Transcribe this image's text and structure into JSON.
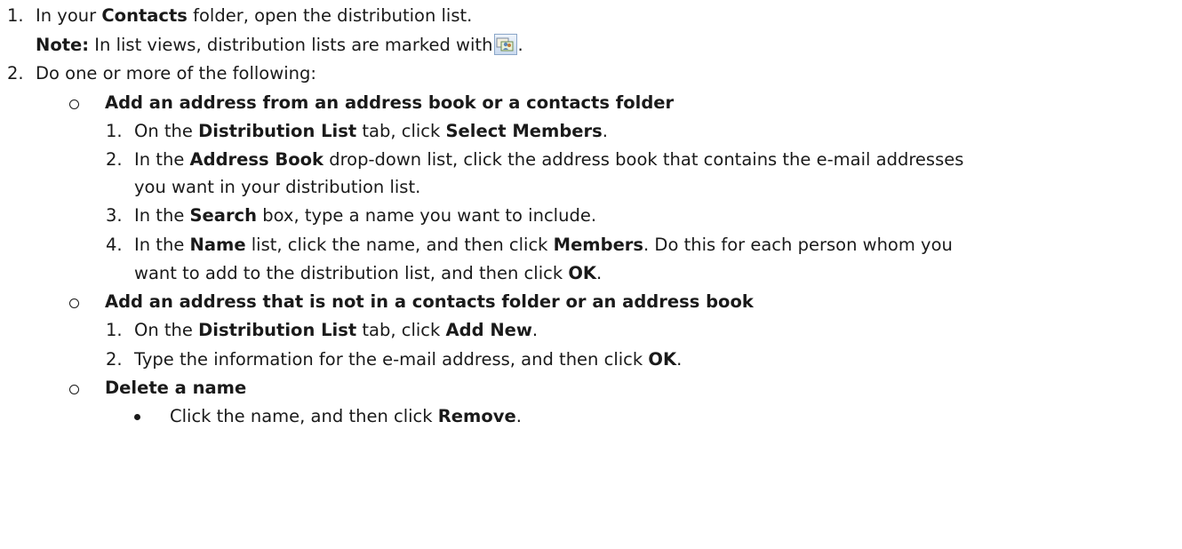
{
  "steps": [
    {
      "number": "1.",
      "text_a": "In your ",
      "bold_a": "Contacts",
      "text_b": " folder, open the distribution list.",
      "note_label": "Note:",
      "note_text": " In list views, distribution lists are marked with",
      "note_end": ".",
      "note_icon": "distribution-list-icon"
    },
    {
      "number": "2.",
      "text": "Do one or more of the following:",
      "options": [
        {
          "marker": "o",
          "title": "Add an address from an address book or a contacts folder",
          "substeps": [
            {
              "number": "1.",
              "t1": "On the ",
              "b1": "Distribution List",
              "t2": " tab, click ",
              "b2": "Select Members",
              "t3": "."
            },
            {
              "number": "2.",
              "t1": "In the ",
              "b1": "Address Book",
              "t2": " drop-down list, click the address book that contains the e-mail addresses",
              "cont": "you want in your distribution list."
            },
            {
              "number": "3.",
              "t1": "In the ",
              "b1": "Search",
              "t2": " box, type a name you want to include."
            },
            {
              "number": "4.",
              "t1": "In the ",
              "b1": "Name",
              "t2": " list, click the name, and then click ",
              "b2": "Members",
              "t3": ". Do this for each person whom you",
              "cont_a": "want to add to the distribution list, and then click ",
              "cont_b": "OK",
              "cont_c": "."
            }
          ]
        },
        {
          "marker": "o",
          "title": "Add an address that is not in a contacts folder or an address book",
          "substeps": [
            {
              "number": "1.",
              "t1": "On the ",
              "b1": "Distribution List",
              "t2": " tab, click ",
              "b2": "Add New",
              "t3": "."
            },
            {
              "number": "2.",
              "t1": "Type the information for the e-mail address, and then click ",
              "b1": "OK",
              "t2": "."
            }
          ]
        },
        {
          "marker": "o",
          "title": "Delete a name",
          "bullet": {
            "t1": "Click the name, and then click ",
            "b1": "Remove",
            "t2": "."
          }
        }
      ]
    }
  ]
}
